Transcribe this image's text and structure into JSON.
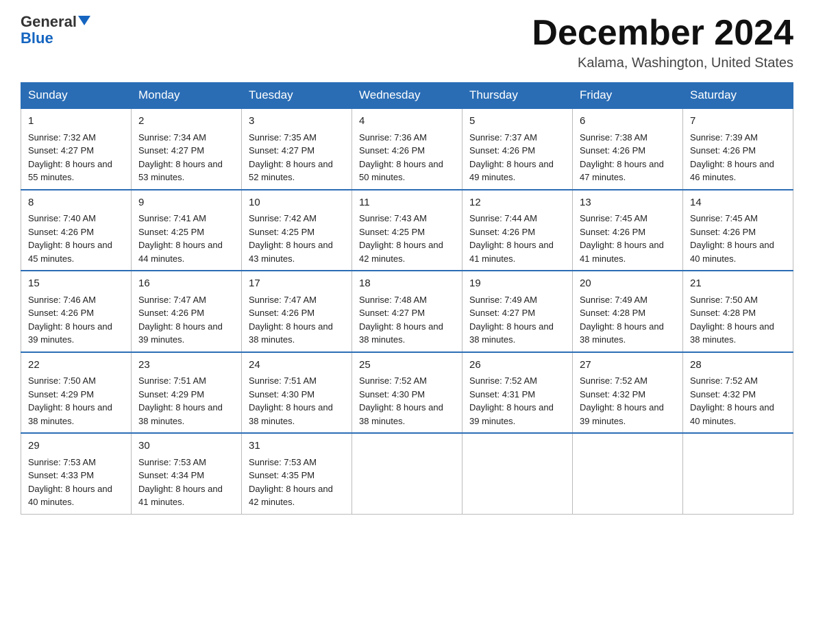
{
  "header": {
    "logo_general": "General",
    "logo_blue": "Blue",
    "month_title": "December 2024",
    "location": "Kalama, Washington, United States"
  },
  "days_of_week": [
    "Sunday",
    "Monday",
    "Tuesday",
    "Wednesday",
    "Thursday",
    "Friday",
    "Saturday"
  ],
  "weeks": [
    [
      {
        "day": "1",
        "sunrise": "7:32 AM",
        "sunset": "4:27 PM",
        "daylight": "8 hours and 55 minutes."
      },
      {
        "day": "2",
        "sunrise": "7:34 AM",
        "sunset": "4:27 PM",
        "daylight": "8 hours and 53 minutes."
      },
      {
        "day": "3",
        "sunrise": "7:35 AM",
        "sunset": "4:27 PM",
        "daylight": "8 hours and 52 minutes."
      },
      {
        "day": "4",
        "sunrise": "7:36 AM",
        "sunset": "4:26 PM",
        "daylight": "8 hours and 50 minutes."
      },
      {
        "day": "5",
        "sunrise": "7:37 AM",
        "sunset": "4:26 PM",
        "daylight": "8 hours and 49 minutes."
      },
      {
        "day": "6",
        "sunrise": "7:38 AM",
        "sunset": "4:26 PM",
        "daylight": "8 hours and 47 minutes."
      },
      {
        "day": "7",
        "sunrise": "7:39 AM",
        "sunset": "4:26 PM",
        "daylight": "8 hours and 46 minutes."
      }
    ],
    [
      {
        "day": "8",
        "sunrise": "7:40 AM",
        "sunset": "4:26 PM",
        "daylight": "8 hours and 45 minutes."
      },
      {
        "day": "9",
        "sunrise": "7:41 AM",
        "sunset": "4:25 PM",
        "daylight": "8 hours and 44 minutes."
      },
      {
        "day": "10",
        "sunrise": "7:42 AM",
        "sunset": "4:25 PM",
        "daylight": "8 hours and 43 minutes."
      },
      {
        "day": "11",
        "sunrise": "7:43 AM",
        "sunset": "4:25 PM",
        "daylight": "8 hours and 42 minutes."
      },
      {
        "day": "12",
        "sunrise": "7:44 AM",
        "sunset": "4:26 PM",
        "daylight": "8 hours and 41 minutes."
      },
      {
        "day": "13",
        "sunrise": "7:45 AM",
        "sunset": "4:26 PM",
        "daylight": "8 hours and 41 minutes."
      },
      {
        "day": "14",
        "sunrise": "7:45 AM",
        "sunset": "4:26 PM",
        "daylight": "8 hours and 40 minutes."
      }
    ],
    [
      {
        "day": "15",
        "sunrise": "7:46 AM",
        "sunset": "4:26 PM",
        "daylight": "8 hours and 39 minutes."
      },
      {
        "day": "16",
        "sunrise": "7:47 AM",
        "sunset": "4:26 PM",
        "daylight": "8 hours and 39 minutes."
      },
      {
        "day": "17",
        "sunrise": "7:47 AM",
        "sunset": "4:26 PM",
        "daylight": "8 hours and 38 minutes."
      },
      {
        "day": "18",
        "sunrise": "7:48 AM",
        "sunset": "4:27 PM",
        "daylight": "8 hours and 38 minutes."
      },
      {
        "day": "19",
        "sunrise": "7:49 AM",
        "sunset": "4:27 PM",
        "daylight": "8 hours and 38 minutes."
      },
      {
        "day": "20",
        "sunrise": "7:49 AM",
        "sunset": "4:28 PM",
        "daylight": "8 hours and 38 minutes."
      },
      {
        "day": "21",
        "sunrise": "7:50 AM",
        "sunset": "4:28 PM",
        "daylight": "8 hours and 38 minutes."
      }
    ],
    [
      {
        "day": "22",
        "sunrise": "7:50 AM",
        "sunset": "4:29 PM",
        "daylight": "8 hours and 38 minutes."
      },
      {
        "day": "23",
        "sunrise": "7:51 AM",
        "sunset": "4:29 PM",
        "daylight": "8 hours and 38 minutes."
      },
      {
        "day": "24",
        "sunrise": "7:51 AM",
        "sunset": "4:30 PM",
        "daylight": "8 hours and 38 minutes."
      },
      {
        "day": "25",
        "sunrise": "7:52 AM",
        "sunset": "4:30 PM",
        "daylight": "8 hours and 38 minutes."
      },
      {
        "day": "26",
        "sunrise": "7:52 AM",
        "sunset": "4:31 PM",
        "daylight": "8 hours and 39 minutes."
      },
      {
        "day": "27",
        "sunrise": "7:52 AM",
        "sunset": "4:32 PM",
        "daylight": "8 hours and 39 minutes."
      },
      {
        "day": "28",
        "sunrise": "7:52 AM",
        "sunset": "4:32 PM",
        "daylight": "8 hours and 40 minutes."
      }
    ],
    [
      {
        "day": "29",
        "sunrise": "7:53 AM",
        "sunset": "4:33 PM",
        "daylight": "8 hours and 40 minutes."
      },
      {
        "day": "30",
        "sunrise": "7:53 AM",
        "sunset": "4:34 PM",
        "daylight": "8 hours and 41 minutes."
      },
      {
        "day": "31",
        "sunrise": "7:53 AM",
        "sunset": "4:35 PM",
        "daylight": "8 hours and 42 minutes."
      },
      null,
      null,
      null,
      null
    ]
  ]
}
